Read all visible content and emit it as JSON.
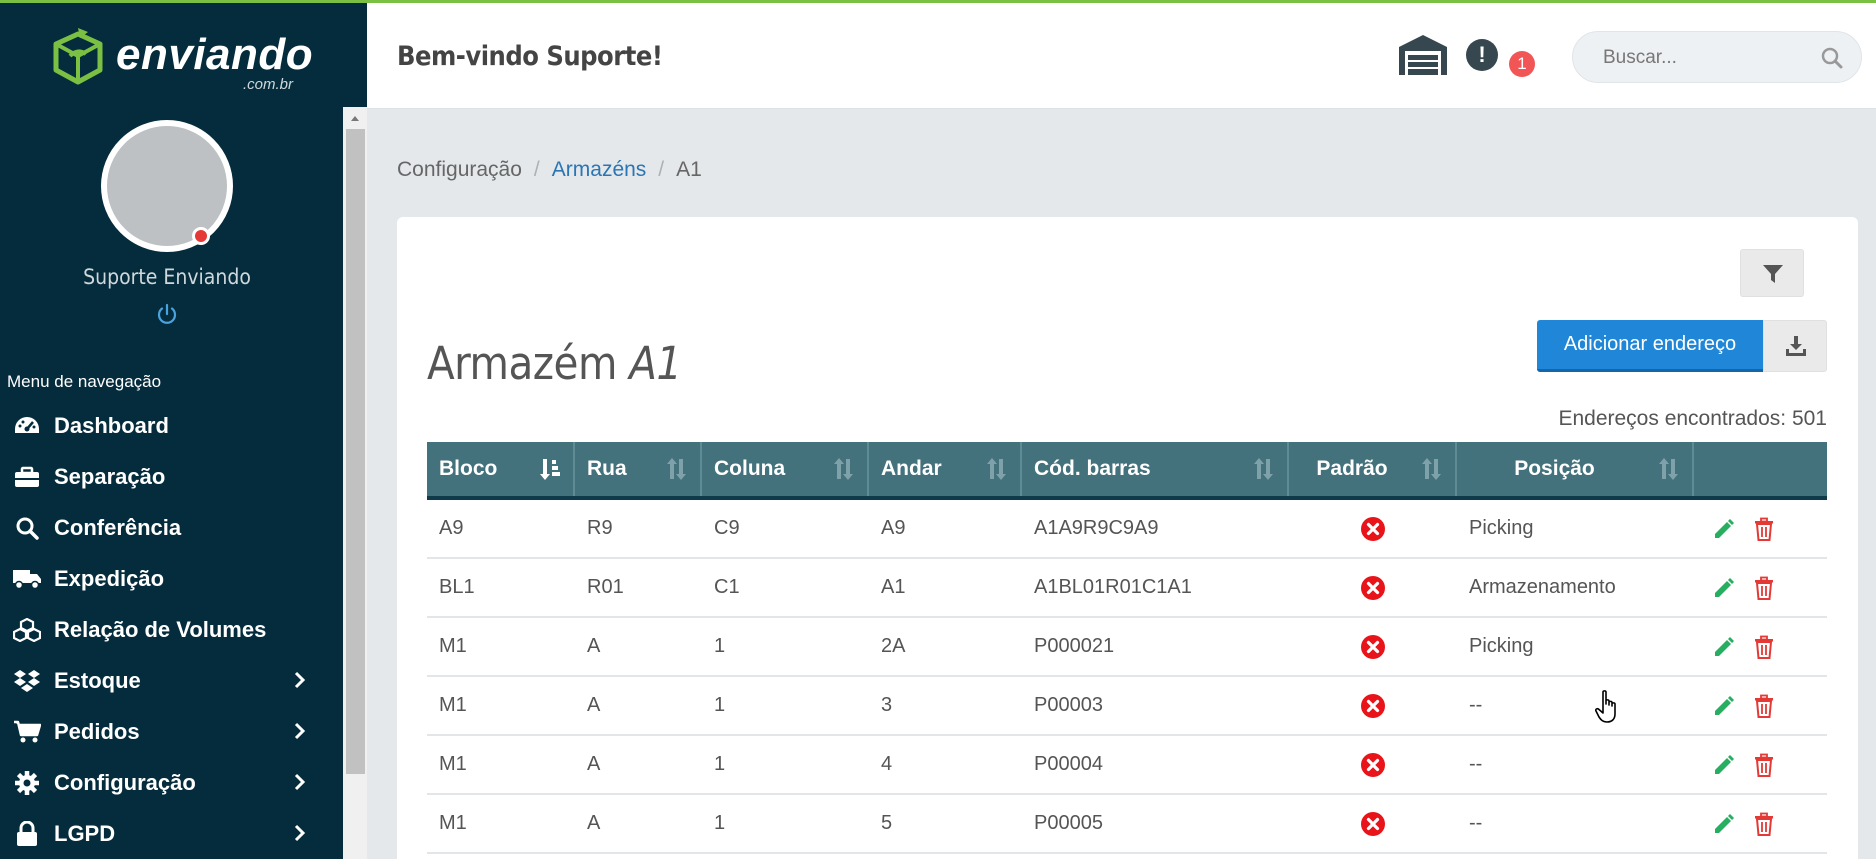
{
  "brand": {
    "name": "enviando",
    "domain": ".com.br"
  },
  "user": {
    "name": "Suporte Enviando"
  },
  "nav": {
    "title": "Menu de navegação",
    "items": [
      {
        "label": "Dashboard",
        "icon": "dashboard-icon",
        "submenu": false
      },
      {
        "label": "Separação",
        "icon": "briefcase-icon",
        "submenu": false
      },
      {
        "label": "Conferência",
        "icon": "search-icon",
        "submenu": false
      },
      {
        "label": "Expedição",
        "icon": "truck-icon",
        "submenu": false
      },
      {
        "label": "Relação de Volumes",
        "icon": "cubes-icon",
        "submenu": false
      },
      {
        "label": "Estoque",
        "icon": "dropbox-icon",
        "submenu": true
      },
      {
        "label": "Pedidos",
        "icon": "cart-icon",
        "submenu": true
      },
      {
        "label": "Configuração",
        "icon": "gear-icon",
        "submenu": true
      },
      {
        "label": "LGPD",
        "icon": "lock-icon",
        "submenu": true
      }
    ]
  },
  "header": {
    "welcome": "Bem-vindo Suporte!",
    "alert_symbol": "!",
    "alert_count": "1",
    "search_placeholder": "Buscar..."
  },
  "breadcrumb": {
    "root": "Configuração",
    "parent": "Armazéns",
    "current": "A1"
  },
  "page": {
    "title_prefix": "Armazém",
    "title_name": "A1",
    "add_button": "Adicionar endereço",
    "count_text": "Endereços encontrados: 501"
  },
  "table": {
    "columns": [
      "Bloco",
      "Rua",
      "Coluna",
      "Andar",
      "Cód. barras",
      "Padrão",
      "Posição",
      ""
    ],
    "rows": [
      {
        "bloco": "A9",
        "rua": "R9",
        "coluna": "C9",
        "andar": "A9",
        "barcode": "A1A9R9C9A9",
        "padrao": false,
        "posicao": "Picking"
      },
      {
        "bloco": "BL1",
        "rua": "R01",
        "coluna": "C1",
        "andar": "A1",
        "barcode": "A1BL01R01C1A1",
        "padrao": false,
        "posicao": "Armazenamento"
      },
      {
        "bloco": "M1",
        "rua": "A",
        "coluna": "1",
        "andar": "2A",
        "barcode": "P000021",
        "padrao": false,
        "posicao": "Picking"
      },
      {
        "bloco": "M1",
        "rua": "A",
        "coluna": "1",
        "andar": "3",
        "barcode": "P00003",
        "padrao": false,
        "posicao": "--"
      },
      {
        "bloco": "M1",
        "rua": "A",
        "coluna": "1",
        "andar": "4",
        "barcode": "P00004",
        "padrao": false,
        "posicao": "--"
      },
      {
        "bloco": "M1",
        "rua": "A",
        "coluna": "1",
        "andar": "5",
        "barcode": "P00005",
        "padrao": false,
        "posicao": "--"
      }
    ]
  },
  "colors": {
    "sidebar_bg": "#052c3c",
    "accent_green": "#7bc043",
    "primary_blue": "#1f86d8",
    "table_header": "#43727c",
    "danger_red": "#e53935",
    "edit_green": "#27ae60"
  }
}
